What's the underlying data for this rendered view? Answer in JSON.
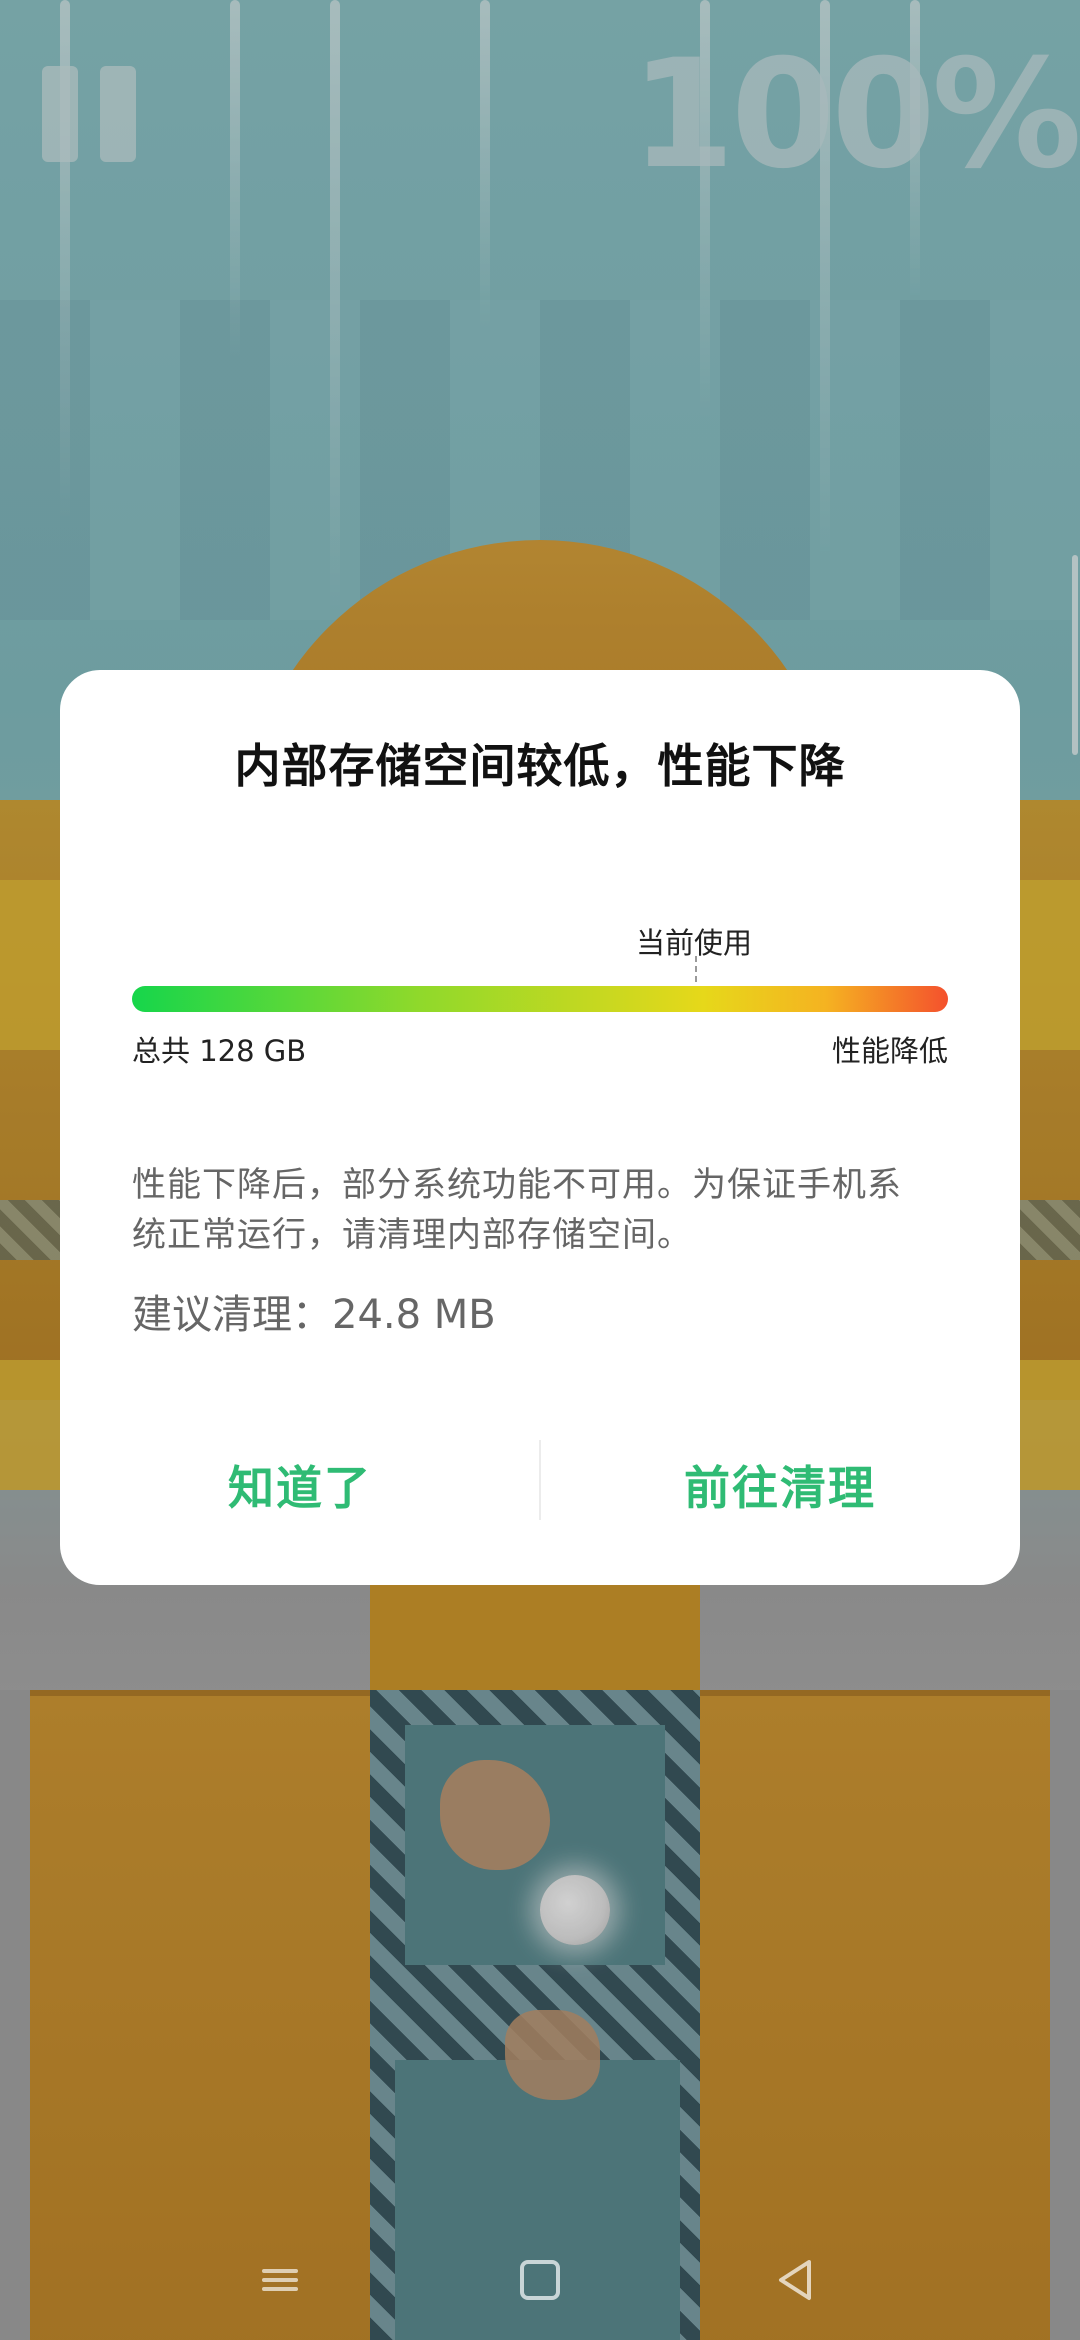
{
  "game": {
    "progress_text": "100%",
    "pause_icon": "pause-icon"
  },
  "dialog": {
    "title": "内部存储空间较低，性能下降",
    "current_usage_label": "当前使用",
    "storage_bar": {
      "current_position_fraction": 0.69
    },
    "total_label": "总共 128 GB",
    "degrade_label": "性能降低",
    "body": "性能下降后，部分系统功能不可用。为保证手机系统正常运行，请清理内部存储空间。",
    "suggest_clean": "建议清理：24.8 MB",
    "buttons": {
      "dismiss": "知道了",
      "go_clean": "前往清理"
    },
    "accent_color": "#2fbb74"
  },
  "navbar": {
    "icons": [
      "menu-icon",
      "home-icon",
      "back-icon"
    ]
  }
}
